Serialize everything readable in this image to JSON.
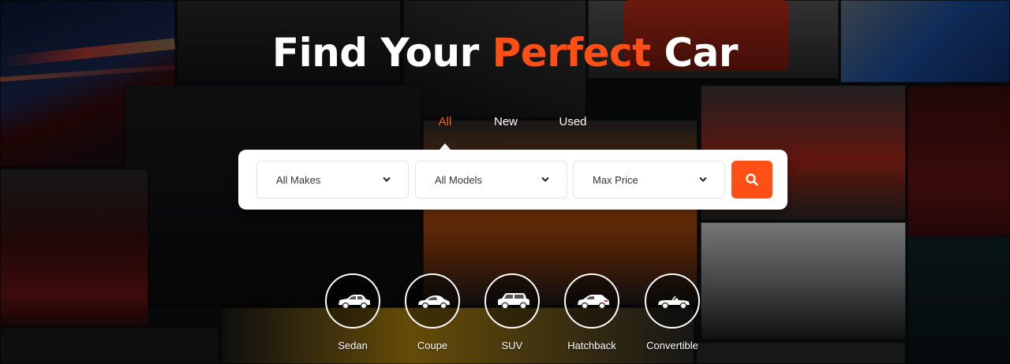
{
  "hero": {
    "title_part1": "Find Your ",
    "title_accent": "Perfect",
    "title_part2": " Car",
    "accent_color": "#ff4f14"
  },
  "tabs": [
    {
      "label": "All",
      "active": true
    },
    {
      "label": "New",
      "active": false
    },
    {
      "label": "Used",
      "active": false
    }
  ],
  "search": {
    "makes": {
      "value": "All Makes"
    },
    "models": {
      "value": "All Models"
    },
    "price": {
      "value": "Max Price"
    },
    "button_icon": "search-icon"
  },
  "body_types": [
    {
      "label": "Sedan",
      "icon": "sedan-icon"
    },
    {
      "label": "Coupe",
      "icon": "coupe-icon"
    },
    {
      "label": "SUV",
      "icon": "suv-icon"
    },
    {
      "label": "Hatchback",
      "icon": "hatchback-icon"
    },
    {
      "label": "Convertible",
      "icon": "convertible-icon"
    }
  ]
}
